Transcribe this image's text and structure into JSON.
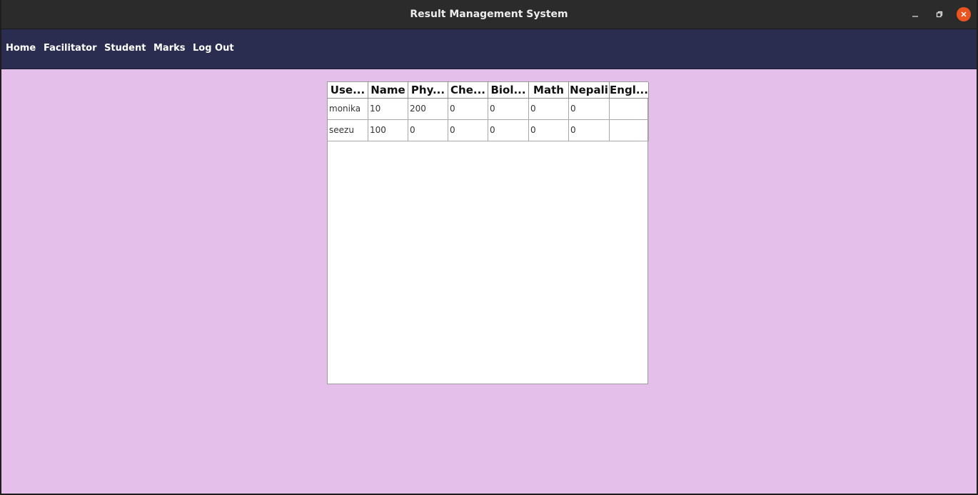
{
  "window": {
    "title": "Result Management System"
  },
  "menu": {
    "items": [
      "Home",
      "Facilitator",
      "Student",
      "Marks",
      "Log Out"
    ]
  },
  "table": {
    "columns": [
      "Use...",
      "Name",
      "Phy...",
      "Che...",
      "Biol...",
      "Math",
      "Nepali",
      "Engl..."
    ],
    "rows": [
      [
        "monika",
        "10",
        "200",
        "0",
        "0",
        "0",
        "0",
        ""
      ],
      [
        "seezu",
        "100",
        "0",
        "0",
        "0",
        "0",
        "0",
        ""
      ]
    ]
  },
  "colors": {
    "titlebar": "#2b2b2b",
    "menubar": "#2b2d50",
    "background": "#e3bfea",
    "close_button": "#e95420"
  }
}
